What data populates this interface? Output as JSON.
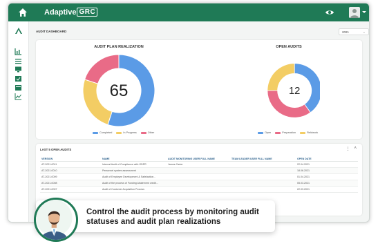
{
  "app": {
    "logo_prefix": "Adaptive",
    "logo_suffix": "GRC"
  },
  "icons": {
    "home": "home-icon",
    "visibility": "eye-icon",
    "user": "user-avatar-icon",
    "sidebar": [
      "app-logo-icon",
      "bar-chart-icon",
      "list-icon",
      "monitor-icon",
      "calendar-check-icon",
      "calendar-icon",
      "line-chart-icon"
    ]
  },
  "dashboard": {
    "title": "AUDIT DASHBOARD",
    "year_selected": "2021"
  },
  "colors": {
    "brand": "#1f7a56",
    "completed": "#5b9be6",
    "in_progress": "#f3cd64",
    "other": "#e96b87",
    "open": "#5b9be6",
    "preparation": "#e96b87",
    "fieldwork": "#f3cd64"
  },
  "chart_data": [
    {
      "type": "pie",
      "title": "AUDIT PLAN REALIZATION",
      "center_label": "65",
      "categories": [
        "Completed",
        "In Progress",
        "Other"
      ],
      "values": [
        55,
        25,
        20
      ],
      "legend": "bottom"
    },
    {
      "type": "pie",
      "title": "OPEN AUDITS",
      "center_label": "12",
      "categories": [
        "Open",
        "Preparation",
        "Fieldwork"
      ],
      "values": [
        40,
        35,
        25
      ],
      "legend": "bottom"
    }
  ],
  "open_audits": {
    "title": "LAST 5 OPEN AUDITS",
    "actions": [
      "⋮",
      "˄"
    ],
    "columns": [
      "VERSION",
      "NAME",
      "AUDIT MONITORING USER FULL NAME",
      "TEAM LEADER USER FULL NAME",
      "OPEN DATE"
    ],
    "rows": [
      [
        "AT-2021-0011",
        "Internal Audit of Compliance with GDPR",
        "James Carter",
        "",
        "22.04.2021"
      ],
      [
        "AT-2021-0010",
        "Personnel system assessment",
        "",
        "",
        "18.06.2021"
      ],
      [
        "AT-2021-0009",
        "Audit of Employee Development & Satisfaction...",
        "",
        "",
        "01.04.2021"
      ],
      [
        "AT-2021-0008",
        "Audit of the process of Funding Abatement credit...",
        "",
        "",
        "05.03.2021"
      ],
      [
        "AT-2021-0007",
        "Audit of Customer Acquisition Process",
        "",
        "",
        "22.03.2021"
      ]
    ]
  },
  "banner": {
    "text": "Control the audit process by monitoring audit statuses and audit plan realizations"
  }
}
